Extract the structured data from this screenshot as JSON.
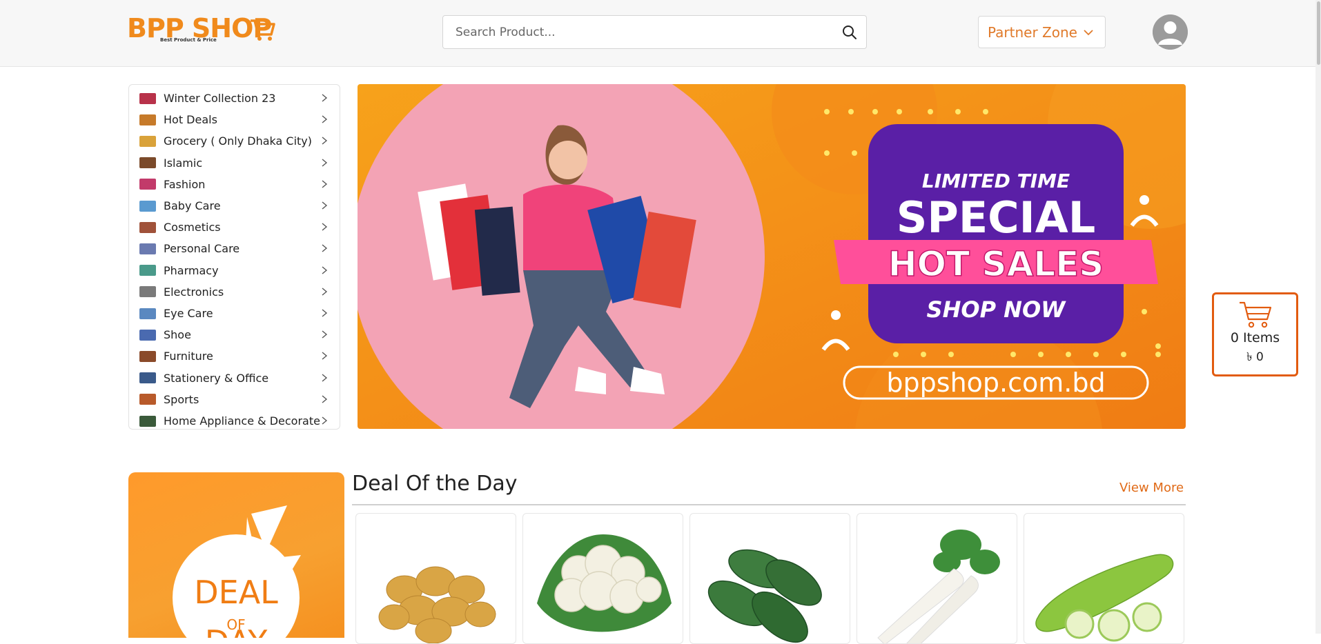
{
  "header": {
    "logo_text": "BPP SHOP",
    "logo_tagline": "Best Product & Price",
    "search_placeholder": "Search Product...",
    "partner_zone_label": "Partner Zone"
  },
  "categories": [
    {
      "label": "Winter Collection 23",
      "icon": "winter-collection-icon"
    },
    {
      "label": "Hot Deals",
      "icon": "hot-deals-icon"
    },
    {
      "label": "Grocery ( Only Dhaka City)",
      "icon": "grocery-icon"
    },
    {
      "label": "Islamic",
      "icon": "islamic-icon"
    },
    {
      "label": "Fashion",
      "icon": "fashion-icon"
    },
    {
      "label": "Baby Care",
      "icon": "baby-care-icon"
    },
    {
      "label": "Cosmetics",
      "icon": "cosmetics-icon"
    },
    {
      "label": "Personal Care",
      "icon": "personal-care-icon"
    },
    {
      "label": "Pharmacy",
      "icon": "pharmacy-icon"
    },
    {
      "label": "Electronics",
      "icon": "electronics-icon"
    },
    {
      "label": "Eye Care",
      "icon": "eye-care-icon"
    },
    {
      "label": "Shoe",
      "icon": "shoe-icon"
    },
    {
      "label": "Furniture",
      "icon": "furniture-icon"
    },
    {
      "label": "Stationery & Office",
      "icon": "stationery-icon"
    },
    {
      "label": "Sports",
      "icon": "sports-icon"
    },
    {
      "label": "Home Appliance & Decorate",
      "icon": "home-appliance-icon"
    }
  ],
  "banner": {
    "line1": "LIMITED TIME",
    "line2": "SPECIAL",
    "line3": "HOT SALES",
    "line4": "SHOP NOW",
    "url": "bppshop.com.bd"
  },
  "cart": {
    "items": "0 Items",
    "total": "৳ 0"
  },
  "deal": {
    "title": "Deal Of the Day",
    "view_more": "View More",
    "badge_line1": "DEAL",
    "badge_line2": "OF",
    "badge_line3": "DAY",
    "products": [
      {
        "name": "potato"
      },
      {
        "name": "cauliflower"
      },
      {
        "name": "pointed gourd"
      },
      {
        "name": "radish"
      },
      {
        "name": "bottle gourd"
      }
    ]
  },
  "colors": {
    "brand_orange": "#f08a1c",
    "accent_orange": "#e06a17",
    "banner_purple": "#5a1fa6",
    "banner_pink": "#ff4f9a"
  }
}
